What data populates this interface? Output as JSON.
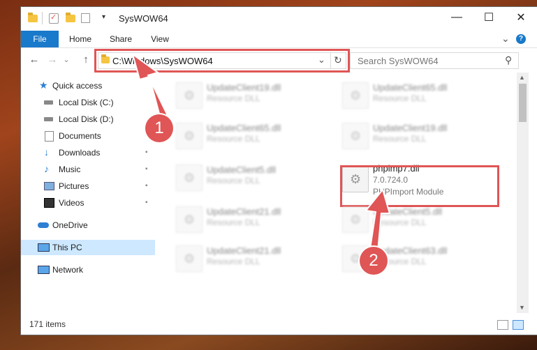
{
  "window": {
    "title": "SysWOW64",
    "minimize_glyph": "—",
    "maximize_glyph": "☐",
    "close_glyph": "✕"
  },
  "ribbon": {
    "tabs": [
      "File",
      "Home",
      "Share",
      "View"
    ],
    "expand_glyph": "⌄",
    "help_glyph": "?"
  },
  "navigation": {
    "back_glyph": "←",
    "forward_glyph": "→",
    "recent_glyph": "⌄",
    "up_glyph": "↑",
    "address": "C:\\Windows\\SysWOW64",
    "dropdown_glyph": "⌄",
    "refresh_glyph": "↻",
    "search_placeholder": "Search SysWOW64",
    "search_glyph": "⚲"
  },
  "sidebar": {
    "items": [
      {
        "label": "Quick access",
        "icon": "star-icon"
      },
      {
        "label": "Local Disk (C:)",
        "icon": "drive-icon"
      },
      {
        "label": "Local Disk (D:)",
        "icon": "drive-icon"
      },
      {
        "label": "Documents",
        "icon": "documents-icon"
      },
      {
        "label": "Downloads",
        "icon": "download-icon"
      },
      {
        "label": "Music",
        "icon": "music-icon"
      },
      {
        "label": "Pictures",
        "icon": "pictures-icon"
      },
      {
        "label": "Videos",
        "icon": "videos-icon"
      },
      {
        "label": "OneDrive",
        "icon": "cloud-icon"
      },
      {
        "label": "This PC",
        "icon": "computer-icon"
      },
      {
        "label": "Network",
        "icon": "network-icon"
      }
    ],
    "pin_glyph": "📌"
  },
  "files": [
    {
      "name": "UpdateClient19.dll",
      "desc": "Resource DLL"
    },
    {
      "name": "UpdateClient65.dll",
      "desc": "Resource DLL"
    },
    {
      "name": "UpdateClient65.dll",
      "desc": "Resource DLL"
    },
    {
      "name": "UpdateClient19.dll",
      "desc": "Resource DLL"
    },
    {
      "name": "UpdateClient5.dll",
      "desc": "Resource DLL"
    },
    {
      "name": "phpimp7.dll",
      "version": "7.0.724.0",
      "desc": "PHPImport Module"
    },
    {
      "name": "UpdateClient21.dll",
      "desc": "Resource DLL"
    },
    {
      "name": "UpdateClient5.dll",
      "desc": "Resource DLL"
    },
    {
      "name": "UpdateClient21.dll",
      "desc": "Resource DLL"
    },
    {
      "name": "UpdateClient63.dll",
      "desc": "Resource DLL"
    }
  ],
  "status": {
    "item_count": "171 items"
  },
  "callouts": {
    "step1": "1",
    "step2": "2"
  },
  "colors": {
    "accent": "#1979ca",
    "highlight": "#e05555"
  }
}
